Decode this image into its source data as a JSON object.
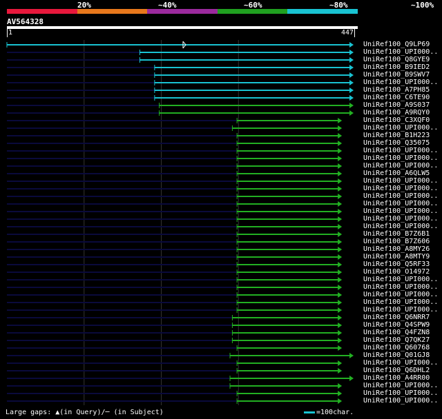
{
  "legend": {
    "labels": [
      "20%",
      "~40%",
      "~60%",
      "~80%",
      "~100%"
    ],
    "colors": [
      "#e8183c",
      "#e8781c",
      "#9b2a9d",
      "#20a020",
      "#19c3d2"
    ]
  },
  "query": {
    "name": "AV564328",
    "start": "1",
    "end": "447",
    "length": 447
  },
  "footer": {
    "gaps_text": "Large gaps: ▲(in Query)/─ (in Subject)",
    "scale_text": "=100char."
  },
  "colors": {
    "cyan": "#19c3d2",
    "green": "#22b022",
    "gridline": "#333333",
    "track": "#0a0a3c"
  },
  "hits": [
    {
      "label": "UniRef100_Q9LP69",
      "start": 1,
      "end": 447,
      "color": "cyan",
      "marker": true
    },
    {
      "label": "UniRef100_UPI000..",
      "start": 172,
      "end": 447,
      "color": "cyan"
    },
    {
      "label": "UniRef100_Q8GYE9",
      "start": 172,
      "end": 447,
      "color": "cyan"
    },
    {
      "label": "UniRef100_B9IED2",
      "start": 191,
      "end": 447,
      "color": "cyan"
    },
    {
      "label": "UniRef100_B9SWV7",
      "start": 191,
      "end": 447,
      "color": "cyan"
    },
    {
      "label": "UniRef100_UPI000..",
      "start": 191,
      "end": 447,
      "color": "cyan"
    },
    {
      "label": "UniRef100_A7PH85",
      "start": 191,
      "end": 447,
      "color": "cyan"
    },
    {
      "label": "UniRef100_C6TE90",
      "start": 191,
      "end": 447,
      "color": "cyan"
    },
    {
      "label": "UniRef100_A9S037",
      "start": 197,
      "end": 447,
      "color": "green"
    },
    {
      "label": "UniRef100_A9RQY0",
      "start": 197,
      "end": 447,
      "color": "green"
    },
    {
      "label": "UniRef100_C3XQF0",
      "start": 297,
      "end": 432,
      "color": "green"
    },
    {
      "label": "UniRef100_UPI000..",
      "start": 291,
      "end": 432,
      "color": "green"
    },
    {
      "label": "UniRef100_B1H223",
      "start": 297,
      "end": 432,
      "color": "green"
    },
    {
      "label": "UniRef100_Q35075",
      "start": 297,
      "end": 432,
      "color": "green"
    },
    {
      "label": "UniRef100_UPI000..",
      "start": 297,
      "end": 432,
      "color": "green"
    },
    {
      "label": "UniRef100_UPI000..",
      "start": 297,
      "end": 432,
      "color": "green"
    },
    {
      "label": "UniRef100_UPI000..",
      "start": 297,
      "end": 432,
      "color": "green"
    },
    {
      "label": "UniRef100_A6QLW5",
      "start": 297,
      "end": 432,
      "color": "green"
    },
    {
      "label": "UniRef100_UPI000..",
      "start": 297,
      "end": 432,
      "color": "green"
    },
    {
      "label": "UniRef100_UPI000..",
      "start": 297,
      "end": 432,
      "color": "green"
    },
    {
      "label": "UniRef100_UPI000..",
      "start": 297,
      "end": 432,
      "color": "green"
    },
    {
      "label": "UniRef100_UPI000..",
      "start": 297,
      "end": 432,
      "color": "green"
    },
    {
      "label": "UniRef100_UPI000..",
      "start": 297,
      "end": 432,
      "color": "green"
    },
    {
      "label": "UniRef100_UPI000..",
      "start": 297,
      "end": 432,
      "color": "green"
    },
    {
      "label": "UniRef100_UPI000..",
      "start": 297,
      "end": 432,
      "color": "green"
    },
    {
      "label": "UniRef100_B7Z6B1",
      "start": 297,
      "end": 432,
      "color": "green"
    },
    {
      "label": "UniRef100_B7Z606",
      "start": 297,
      "end": 432,
      "color": "green"
    },
    {
      "label": "UniRef100_A8MY26",
      "start": 297,
      "end": 432,
      "color": "green"
    },
    {
      "label": "UniRef100_A8MTY9",
      "start": 297,
      "end": 432,
      "color": "green"
    },
    {
      "label": "UniRef100_Q5RF33",
      "start": 297,
      "end": 432,
      "color": "green"
    },
    {
      "label": "UniRef100_O14972",
      "start": 297,
      "end": 432,
      "color": "green"
    },
    {
      "label": "UniRef100_UPI000..",
      "start": 297,
      "end": 432,
      "color": "green"
    },
    {
      "label": "UniRef100_UPI000..",
      "start": 297,
      "end": 432,
      "color": "green"
    },
    {
      "label": "UniRef100_UPI000..",
      "start": 297,
      "end": 432,
      "color": "green"
    },
    {
      "label": "UniRef100_UPI000..",
      "start": 297,
      "end": 432,
      "color": "green"
    },
    {
      "label": "UniRef100_UPI000..",
      "start": 297,
      "end": 432,
      "color": "green"
    },
    {
      "label": "UniRef100_Q6NRR7",
      "start": 291,
      "end": 432,
      "color": "green"
    },
    {
      "label": "UniRef100_Q4SPW9",
      "start": 291,
      "end": 432,
      "color": "green"
    },
    {
      "label": "UniRef100_Q4FZN8",
      "start": 291,
      "end": 432,
      "color": "green"
    },
    {
      "label": "UniRef100_Q7QK27",
      "start": 291,
      "end": 432,
      "color": "green"
    },
    {
      "label": "UniRef100_Q60768",
      "start": 297,
      "end": 432,
      "color": "green"
    },
    {
      "label": "UniRef100_Q01GJ8",
      "start": 288,
      "end": 447,
      "color": "green"
    },
    {
      "label": "UniRef100_UPI000..",
      "start": 297,
      "end": 432,
      "color": "green"
    },
    {
      "label": "UniRef100_Q6DHL2",
      "start": 297,
      "end": 432,
      "color": "green"
    },
    {
      "label": "UniRef100_A4RR00",
      "start": 288,
      "end": 447,
      "color": "green"
    },
    {
      "label": "UniRef100_UPI000..",
      "start": 288,
      "end": 432,
      "color": "green"
    },
    {
      "label": "UniRef100_UPI000..",
      "start": 297,
      "end": 432,
      "color": "green"
    },
    {
      "label": "UniRef100_UPI000..",
      "start": 297,
      "end": 432,
      "color": "green"
    }
  ]
}
